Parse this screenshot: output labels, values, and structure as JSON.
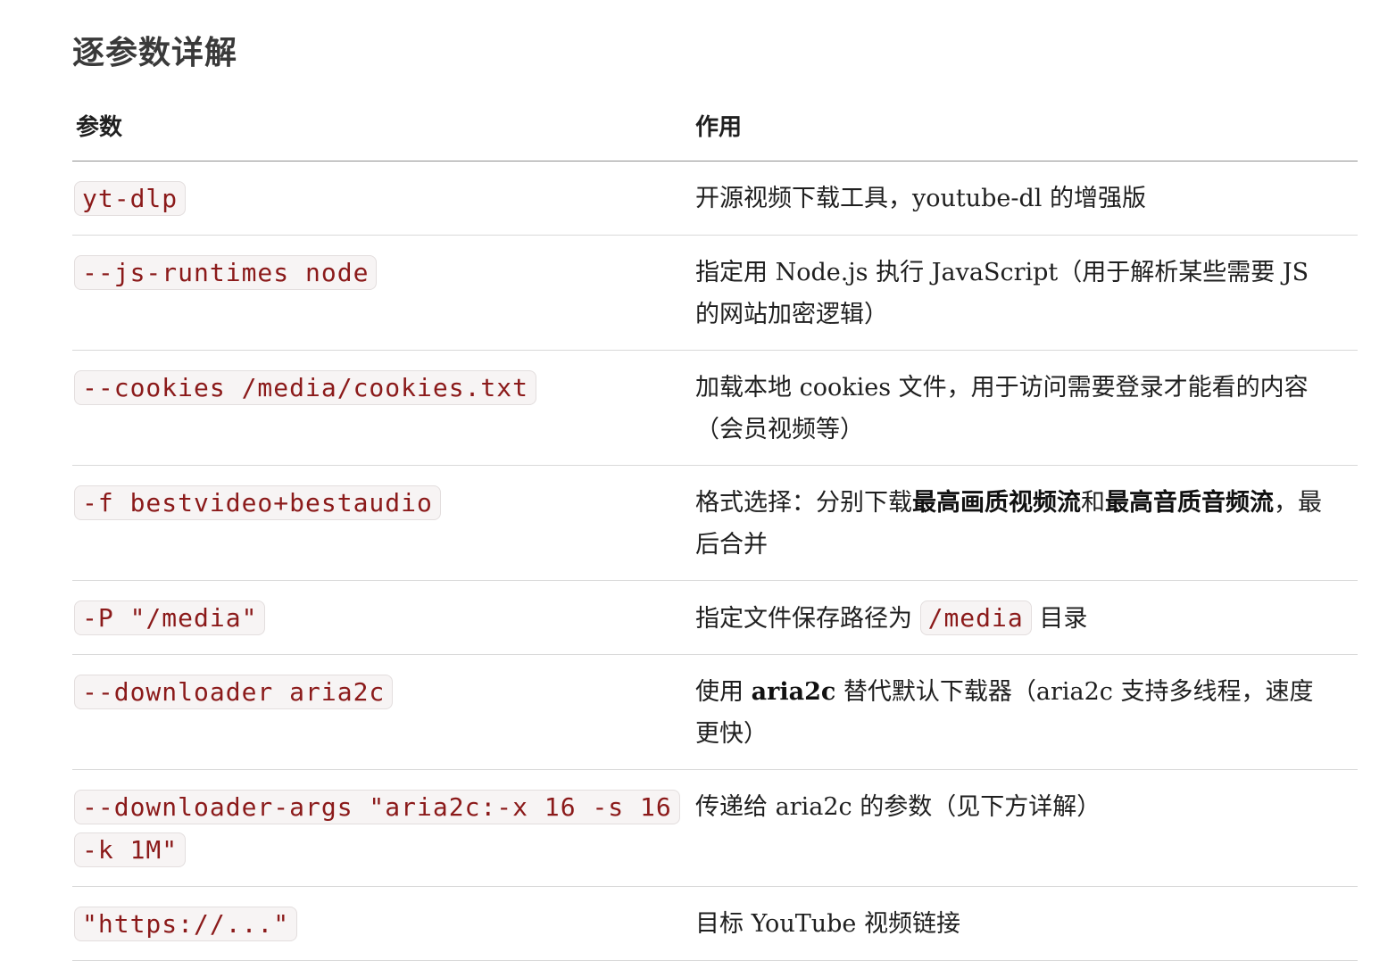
{
  "section": {
    "title": "逐参数详解"
  },
  "table": {
    "headers": {
      "param": "参数",
      "desc": "作用"
    },
    "rows": [
      {
        "param": "yt-dlp",
        "desc": "开源视频下载工具，youtube-dl 的增强版"
      },
      {
        "param": "--js-runtimes node",
        "desc": "指定用 Node.js 执行 JavaScript（用于解析某些需要 JS 的网站加密逻辑）"
      },
      {
        "param": "--cookies /media/cookies.txt",
        "desc": "加载本地 cookies 文件，用于访问需要登录才能看的内容（会员视频等）"
      },
      {
        "param": "-f bestvideo+bestaudio",
        "desc_pre": "格式选择：分别下载",
        "desc_bold1": "最高画质视频流",
        "desc_mid": "和",
        "desc_bold2": "最高音质音频流",
        "desc_post": "，最后合并"
      },
      {
        "param": "-P \"/media\"",
        "desc_pre": "指定文件保存路径为",
        "desc_code": "/media",
        "desc_post": "目录"
      },
      {
        "param": "--downloader aria2c",
        "desc_pre": "使用",
        "desc_bold": "aria2c",
        "desc_post": "替代默认下载器（aria2c 支持多线程，速度更快）"
      },
      {
        "param": "--downloader-args \"aria2c:-x 16 -s 16 -k 1M\"",
        "desc": "传递给 aria2c 的参数（见下方详解）"
      },
      {
        "param": "\"https://...\"",
        "desc": "目标 YouTube 视频链接"
      }
    ]
  }
}
